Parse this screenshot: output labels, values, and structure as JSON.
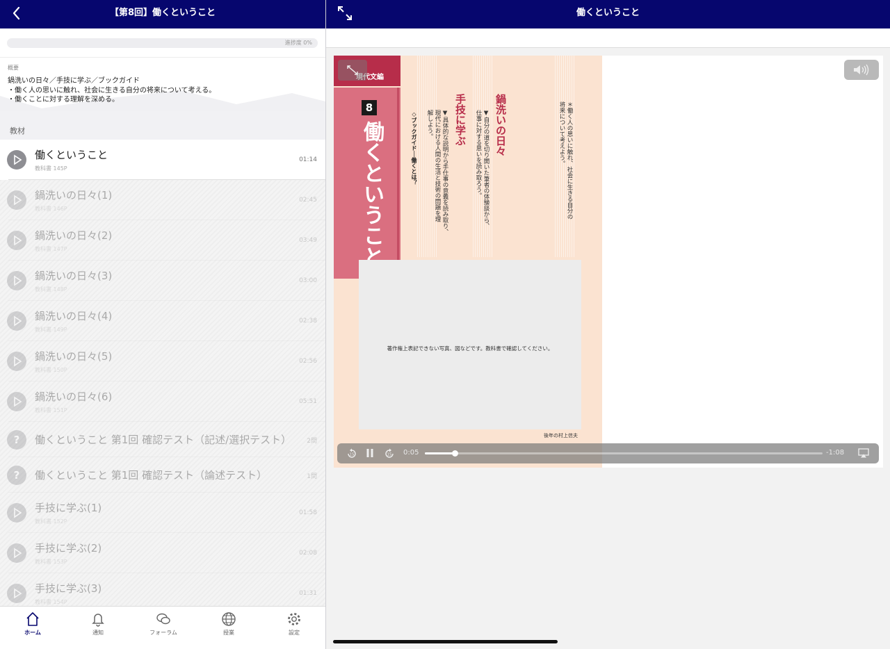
{
  "left_nav": {
    "title": "【第8回】働くということ"
  },
  "progress": {
    "label": "進捗度 0%",
    "value": 0
  },
  "summary": {
    "heading": "概要",
    "body": "鍋洗いの日々／手技に学ぶ／ブックガイド\n・働く人の思いに触れ、社会に生きる自分の将来について考える。\n・働くことに対する理解を深める。"
  },
  "section": {
    "title": "教材"
  },
  "items": [
    {
      "title": "働くということ",
      "sub": "教科書 145P",
      "duration": "01:14",
      "icon": "play-icon"
    },
    {
      "title": "鍋洗いの日々(1)",
      "sub": "教科書 146P",
      "duration": "02:45",
      "icon": "play-icon"
    },
    {
      "title": "鍋洗いの日々(2)",
      "sub": "教科書 147P",
      "duration": "03:49",
      "icon": "play-icon"
    },
    {
      "title": "鍋洗いの日々(3)",
      "sub": "教科書 148P",
      "duration": "03:00",
      "icon": "play-icon"
    },
    {
      "title": "鍋洗いの日々(4)",
      "sub": "教科書 149P",
      "duration": "02:38",
      "icon": "play-icon"
    },
    {
      "title": "鍋洗いの日々(5)",
      "sub": "教科書 150P",
      "duration": "02:56",
      "icon": "play-icon"
    },
    {
      "title": "鍋洗いの日々(6)",
      "sub": "教科書 151P",
      "duration": "05:51",
      "icon": "play-icon"
    },
    {
      "title": "働くということ 第1回 確認テスト（記述/選択テスト）",
      "sub": "",
      "duration": "2問",
      "icon": "question-icon"
    },
    {
      "title": "働くということ 第1回 確認テスト（論述テスト）",
      "sub": "",
      "duration": "1問",
      "icon": "question-icon"
    },
    {
      "title": "手技に学ぶ(1)",
      "sub": "教科書 152P",
      "duration": "01:58",
      "icon": "play-icon"
    },
    {
      "title": "手技に学ぶ(2)",
      "sub": "教科書 153P",
      "duration": "02:08",
      "icon": "play-icon"
    },
    {
      "title": "手技に学ぶ(3)",
      "sub": "教科書 154P",
      "duration": "01:31",
      "icon": "play-icon"
    }
  ],
  "tabs": [
    {
      "label": "ホーム",
      "icon": "home-icon"
    },
    {
      "label": "通知",
      "icon": "bell-icon"
    },
    {
      "label": "フォーラム",
      "icon": "chat-icon"
    },
    {
      "label": "授業",
      "icon": "globe-icon"
    },
    {
      "label": "設定",
      "icon": "gear-icon"
    }
  ],
  "right_nav": {
    "title": "働くということ"
  },
  "page": {
    "tag": "現代文編",
    "chapter_number": "8",
    "chapter_title": "働くということ",
    "goal": "＊働く人の思いに触れ、社会に生きる自分の\n将来について考えよう。",
    "section1_title": "鍋洗いの日々",
    "section1_text": "▼自分の道を切り開いた筆者の体験談から、\n仕事に対する思いを読み取ろう。",
    "section2_title": "手技に学ぶ",
    "section2_text": "▼具体的な説明から手仕事の意義を読み取り、\n現代における人間の生活と技術の問題を理\n解しよう。",
    "guide": "◇ブックガイド──働くとは？",
    "placeholder_note": "著作権上表記できない写真、図などです。教科書で確認してください。",
    "credit": "後年の村上信夫"
  },
  "player": {
    "elapsed": "0:05",
    "remaining": "-1:08",
    "played_fraction": 0.075
  },
  "colors": {
    "nav": "#06066e",
    "accent": "#b72d4a"
  }
}
